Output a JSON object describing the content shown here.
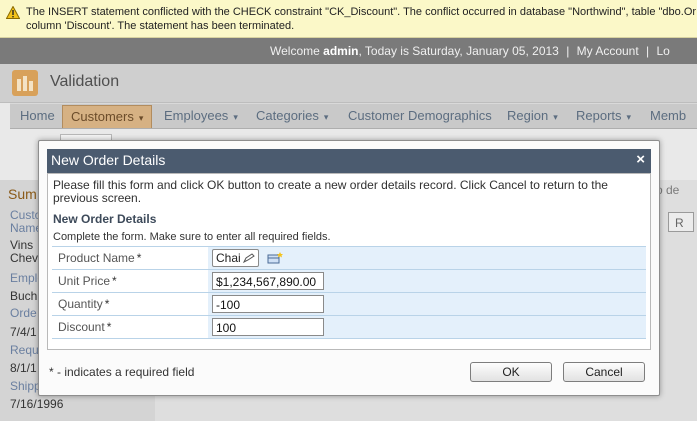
{
  "error": {
    "message_line1": "The INSERT statement conflicted with the CHECK constraint \"CK_Discount\". The conflict occurred in database \"Northwind\", table \"dbo.Or",
    "message_line2": "column 'Discount'. The statement has been terminated."
  },
  "welcome_bar": {
    "prefix": "Welcome ",
    "user": "admin",
    "date_text": ", Today is Saturday, January 05, 2013",
    "separator": "|",
    "my_account": "My Account",
    "logout": "Lo"
  },
  "app": {
    "title": "Validation"
  },
  "menu": {
    "items": [
      {
        "label": "Home",
        "has_caret": false
      },
      {
        "label": "Customers",
        "has_caret": true,
        "active": true
      },
      {
        "label": "Employees",
        "has_caret": true
      },
      {
        "label": "Categories",
        "has_caret": true
      },
      {
        "label": "Customer Demographics",
        "has_caret": false
      },
      {
        "label": "Region",
        "has_caret": true
      },
      {
        "label": "Reports",
        "has_caret": true
      },
      {
        "label": "Memb",
        "has_caret": false
      }
    ],
    "caret": "▾"
  },
  "background": {
    "sidebar_head": "Sum",
    "fields": [
      {
        "label": "Custo",
        "value": ""
      },
      {
        "label": "Name",
        "value": ""
      },
      {
        "label": "",
        "value": "Vins"
      },
      {
        "label": "",
        "value": "Chev"
      },
      {
        "label": "Emplo",
        "value": ""
      },
      {
        "label": "",
        "value": "Buch"
      },
      {
        "label": "Orde",
        "value": ""
      },
      {
        "label": "",
        "value": "7/4/1"
      },
      {
        "label": "Requ",
        "value": ""
      },
      {
        "label": "",
        "value": "8/1/1"
      },
      {
        "label": "Shipp",
        "value": ""
      },
      {
        "label": "",
        "value": "7/16/1996"
      }
    ],
    "right_text": "o de",
    "right_button": "R"
  },
  "dialog": {
    "title": "New Order Details",
    "close_glyph": "×",
    "description": "Please fill this form and click OK button to create a new order details record. Click Cancel to return to the previous screen.",
    "section_title": "New Order Details",
    "section_hint": "Complete the form. Make sure to enter all required fields.",
    "fields": [
      {
        "label": "Product Name",
        "required_mark": "*",
        "value": "Chai",
        "type": "lookup"
      },
      {
        "label": "Unit Price",
        "required_mark": "*",
        "value": "$1,234,567,890.00",
        "type": "text"
      },
      {
        "label": "Quantity",
        "required_mark": "*",
        "value": "-100",
        "type": "text"
      },
      {
        "label": "Discount",
        "required_mark": "*",
        "value": "100",
        "type": "text"
      }
    ],
    "required_note": "* - indicates a required field",
    "ok_label": "OK",
    "cancel_label": "Cancel"
  },
  "colors": {
    "error_background": "#fbf8c8",
    "dialog_title_background": "#4b5b6f",
    "field_background": "#e4f0fb",
    "active_menu": "#d6b183"
  },
  "icons": [
    "warning-icon",
    "app-logo-icon",
    "close-icon",
    "edit-pencil-icon",
    "new-record-icon"
  ]
}
